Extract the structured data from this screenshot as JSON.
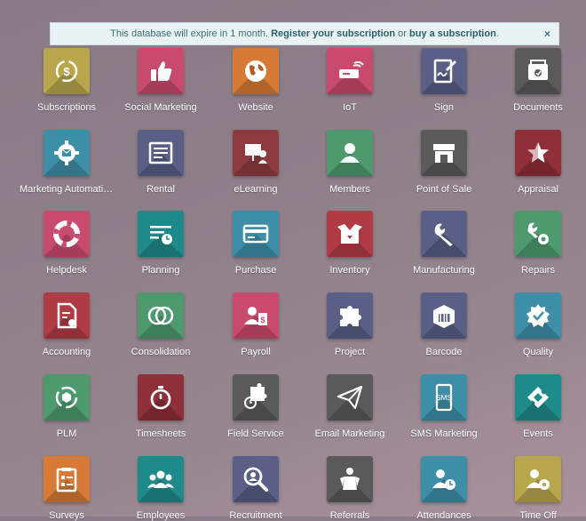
{
  "banner": {
    "text_before": "This database will expire in 1 month. ",
    "link_register": "Register your subscription",
    "text_middle": " or ",
    "link_buy": "buy a subscription",
    "text_after": ".",
    "close": "×"
  },
  "apps": [
    {
      "label": "Subscriptions",
      "icon": "subscriptions-icon",
      "color": "#b8a64c"
    },
    {
      "label": "Social Marketing",
      "icon": "thumbs-up-icon",
      "color": "#c84b6e"
    },
    {
      "label": "Website",
      "icon": "globe-icon",
      "color": "#d67a35"
    },
    {
      "label": "IoT",
      "icon": "iot-icon",
      "color": "#c84b6e"
    },
    {
      "label": "Sign",
      "icon": "sign-icon",
      "color": "#5a5f86"
    },
    {
      "label": "Documents",
      "icon": "documents-icon",
      "color": "#5a5a5a"
    },
    {
      "label": "Marketing Automation",
      "icon": "marketing-automation-icon",
      "color": "#3d8ea6"
    },
    {
      "label": "Rental",
      "icon": "rental-icon",
      "color": "#5a5f86"
    },
    {
      "label": "eLearning",
      "icon": "elearning-icon",
      "color": "#8e3b3f"
    },
    {
      "label": "Members",
      "icon": "members-icon",
      "color": "#4d9a6e"
    },
    {
      "label": "Point of Sale",
      "icon": "store-icon",
      "color": "#5a5a5a"
    },
    {
      "label": "Appraisal",
      "icon": "star-icon",
      "color": "#8e2f3a"
    },
    {
      "label": "Helpdesk",
      "icon": "lifebuoy-icon",
      "color": "#c84b6e"
    },
    {
      "label": "Planning",
      "icon": "planning-icon",
      "color": "#1f8a8a"
    },
    {
      "label": "Purchase",
      "icon": "credit-card-icon",
      "color": "#3d8ea6"
    },
    {
      "label": "Inventory",
      "icon": "box-open-icon",
      "color": "#b03b45"
    },
    {
      "label": "Manufacturing",
      "icon": "wrench-icon",
      "color": "#5a5f86"
    },
    {
      "label": "Repairs",
      "icon": "repairs-icon",
      "color": "#4d9a6e"
    },
    {
      "label": "Accounting",
      "icon": "accounting-icon",
      "color": "#b03b45"
    },
    {
      "label": "Consolidation",
      "icon": "consolidation-icon",
      "color": "#4d9a6e"
    },
    {
      "label": "Payroll",
      "icon": "payroll-icon",
      "color": "#c84b6e"
    },
    {
      "label": "Project",
      "icon": "puzzle-icon",
      "color": "#5a5f86"
    },
    {
      "label": "Barcode",
      "icon": "barcode-box-icon",
      "color": "#5a5f86"
    },
    {
      "label": "Quality",
      "icon": "quality-icon",
      "color": "#3d8ea6"
    },
    {
      "label": "PLM",
      "icon": "plm-icon",
      "color": "#4d9a6e"
    },
    {
      "label": "Timesheets",
      "icon": "stopwatch-icon",
      "color": "#8e2f3a"
    },
    {
      "label": "Field Service",
      "icon": "field-service-icon",
      "color": "#5a5a5a"
    },
    {
      "label": "Email Marketing",
      "icon": "paper-plane-icon",
      "color": "#5a5a5a"
    },
    {
      "label": "SMS Marketing",
      "icon": "sms-icon",
      "color": "#3d8ea6"
    },
    {
      "label": "Events",
      "icon": "ticket-icon",
      "color": "#1f8a8a"
    },
    {
      "label": "Surveys",
      "icon": "surveys-icon",
      "color": "#d67a35"
    },
    {
      "label": "Employees",
      "icon": "employees-icon",
      "color": "#1f8a8a"
    },
    {
      "label": "Recruitment",
      "icon": "magnifier-person-icon",
      "color": "#5a5f86"
    },
    {
      "label": "Referrals",
      "icon": "referrals-icon",
      "color": "#5a5a5a"
    },
    {
      "label": "Attendances",
      "icon": "attendances-icon",
      "color": "#3d8ea6"
    },
    {
      "label": "Time Off",
      "icon": "time-off-icon",
      "color": "#b8a64c"
    }
  ]
}
